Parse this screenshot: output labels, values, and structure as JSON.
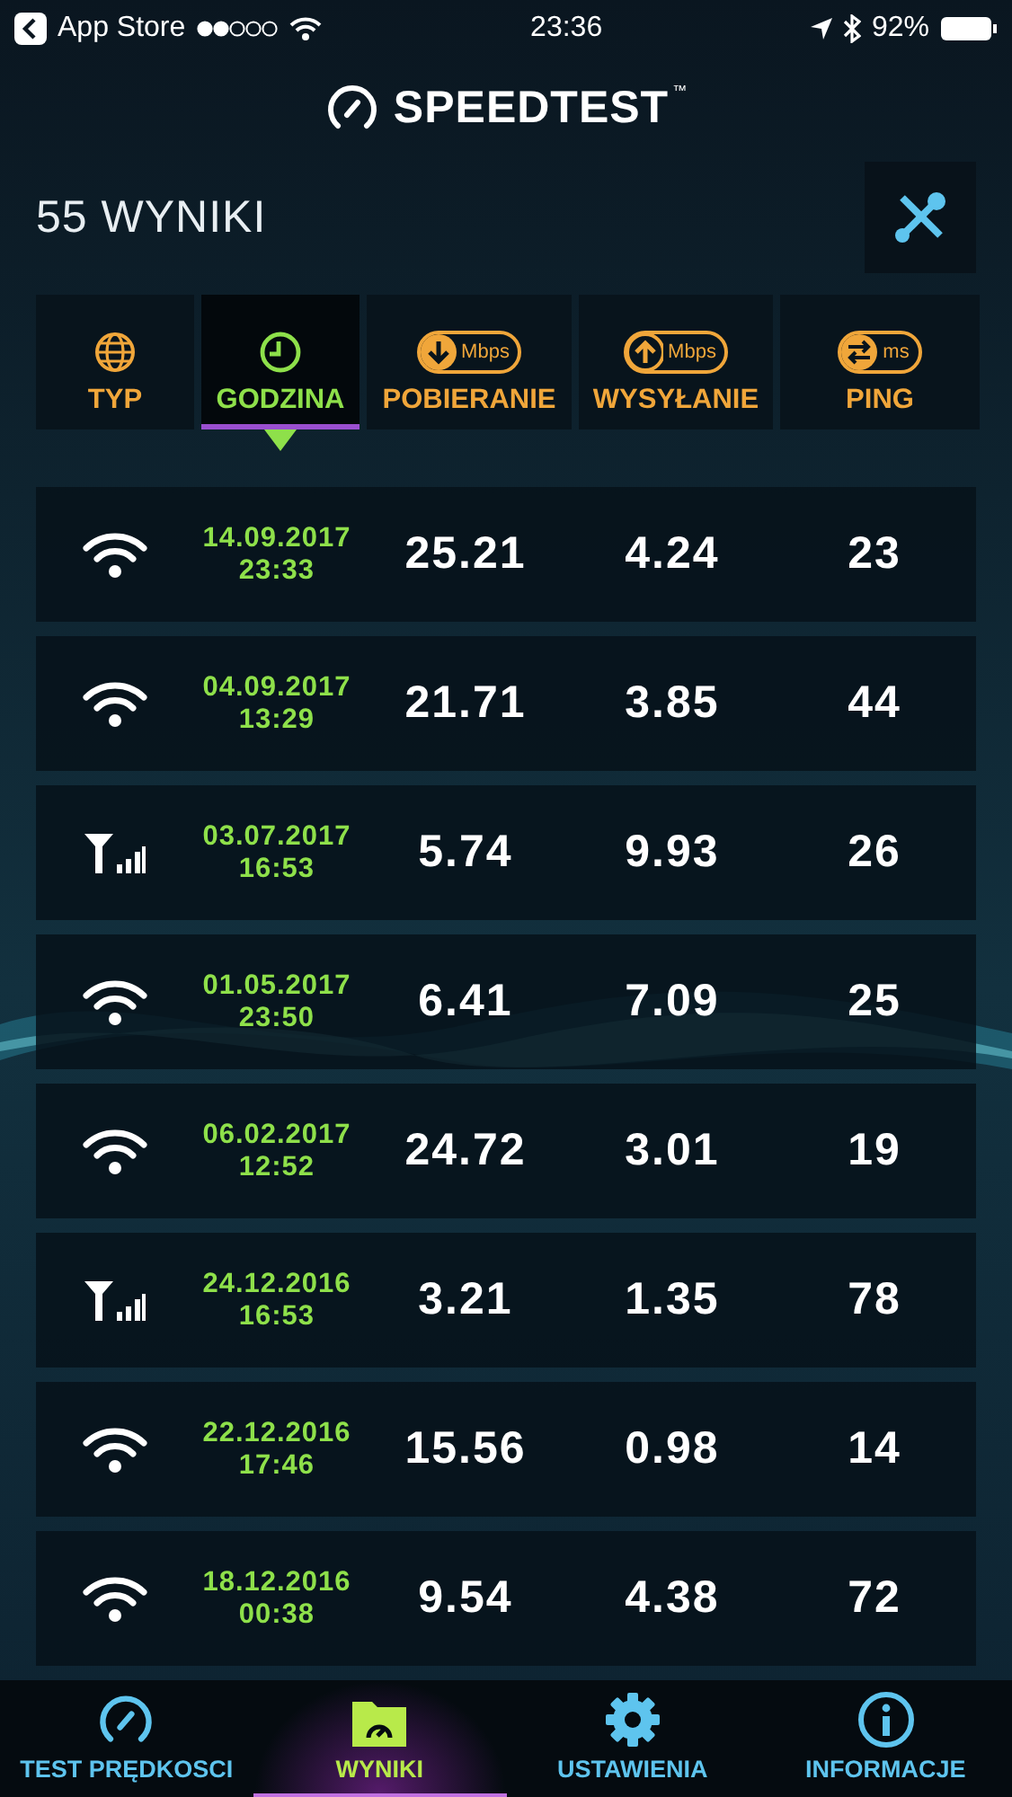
{
  "status_bar": {
    "back_app": "App Store",
    "time": "23:36",
    "battery": "92%"
  },
  "logo": {
    "name": "SPEEDTEST",
    "mark": "™"
  },
  "header": {
    "title": "55 WYNIKI"
  },
  "columns": [
    {
      "kind": "globe",
      "label": "TYP",
      "selected": false
    },
    {
      "kind": "clock",
      "label": "GODZINA",
      "selected": true
    },
    {
      "kind": "download",
      "label": "POBIERANIE",
      "unit": "Mbps",
      "selected": false
    },
    {
      "kind": "upload",
      "label": "WYSYŁANIE",
      "unit": "Mbps",
      "selected": false
    },
    {
      "kind": "ping",
      "label": "PING",
      "unit": "ms",
      "selected": false
    }
  ],
  "rows": [
    {
      "kind": "wifi",
      "date": "14.09.2017",
      "time": "23:33",
      "download": "25.21",
      "upload": "4.24",
      "ping": "23"
    },
    {
      "kind": "wifi",
      "date": "04.09.2017",
      "time": "13:29",
      "download": "21.71",
      "upload": "3.85",
      "ping": "44"
    },
    {
      "kind": "cellular",
      "date": "03.07.2017",
      "time": "16:53",
      "download": "5.74",
      "upload": "9.93",
      "ping": "26"
    },
    {
      "kind": "wifi",
      "date": "01.05.2017",
      "time": "23:50",
      "download": "6.41",
      "upload": "7.09",
      "ping": "25"
    },
    {
      "kind": "wifi",
      "date": "06.02.2017",
      "time": "12:52",
      "download": "24.72",
      "upload": "3.01",
      "ping": "19"
    },
    {
      "kind": "cellular",
      "date": "24.12.2016",
      "time": "16:53",
      "download": "3.21",
      "upload": "1.35",
      "ping": "78"
    },
    {
      "kind": "wifi",
      "date": "22.12.2016",
      "time": "17:46",
      "download": "15.56",
      "upload": "0.98",
      "ping": "14"
    },
    {
      "kind": "wifi",
      "date": "18.12.2016",
      "time": "00:38",
      "download": "9.54",
      "upload": "4.38",
      "ping": "72"
    }
  ],
  "tabs": [
    {
      "kind": "speed",
      "label": "TEST PRĘDKOSCI",
      "selected": false
    },
    {
      "kind": "results",
      "label": "WYNIKI",
      "selected": true
    },
    {
      "kind": "settings",
      "label": "USTAWIENIA",
      "selected": false
    },
    {
      "kind": "info",
      "label": "INFORMACJE",
      "selected": false
    }
  ]
}
